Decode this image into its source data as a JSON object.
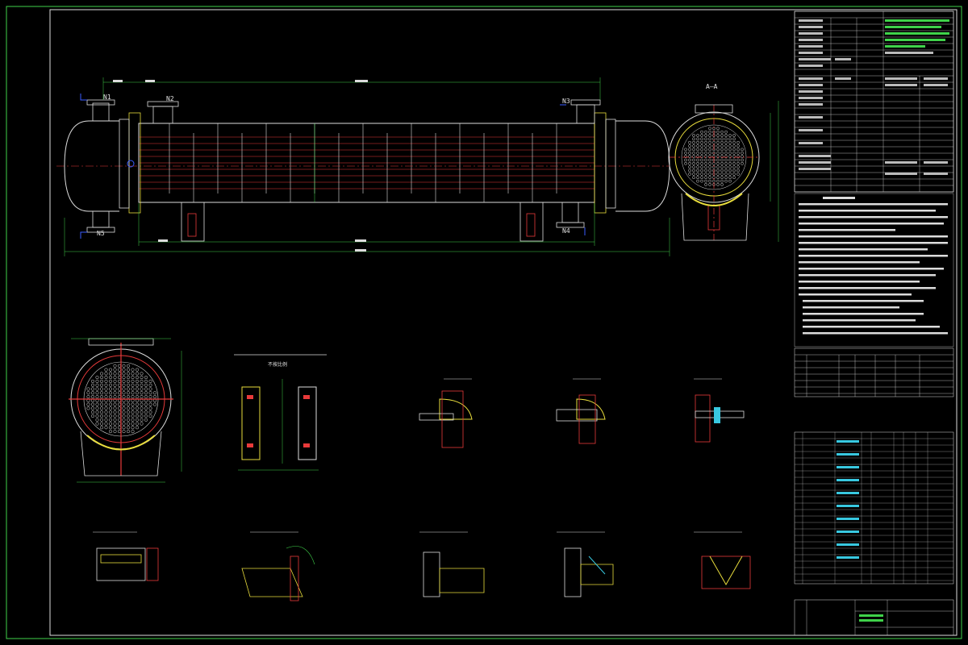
{
  "drawing": {
    "section_label": "A—A",
    "nozzle_labels": [
      "N1",
      "N2",
      "N3",
      "N4",
      "N5"
    ],
    "detail_note": "不按比例",
    "colors": {
      "background": "#000000",
      "border": "#3fd24a",
      "outline": "#dcdcdc",
      "centerline": "#e83a3a",
      "dimension": "#3fd24a",
      "hatch": "#e8dc3c",
      "accent": "#38c8e0"
    }
  }
}
